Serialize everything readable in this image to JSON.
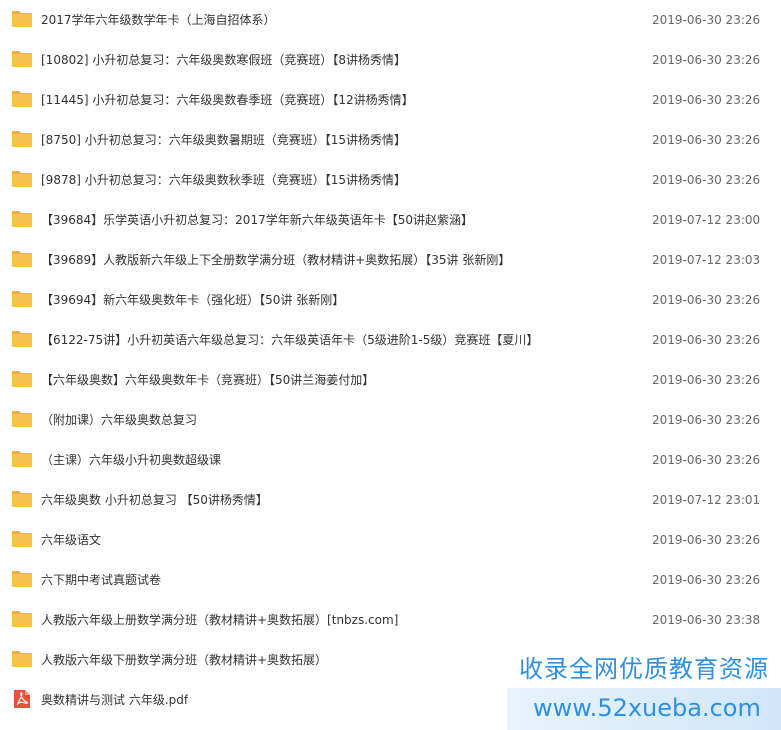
{
  "colors": {
    "folder": "#f7c34a",
    "folder_dark": "#eeb22e",
    "pdf": "#e9503a",
    "watermark": "#2f8fe0"
  },
  "files": [
    {
      "name": "2017学年六年级数学年卡（上海自招体系）",
      "date": "2019-06-30 23:26",
      "icon": "folder-icon"
    },
    {
      "name": "[10802] 小升初总复习：六年级奥数寒假班（竞赛班）【8讲杨秀情】",
      "date": "2019-06-30 23:26",
      "icon": "folder-icon"
    },
    {
      "name": "[11445] 小升初总复习：六年级奥数春季班（竞赛班）【12讲杨秀情】",
      "date": "2019-06-30 23:26",
      "icon": "folder-icon"
    },
    {
      "name": "[8750] 小升初总复习：六年级奥数暑期班（竞赛班）【15讲杨秀情】",
      "date": "2019-06-30 23:26",
      "icon": "folder-icon"
    },
    {
      "name": "[9878] 小升初总复习：六年级奥数秋季班（竞赛班）【15讲杨秀情】",
      "date": "2019-06-30 23:26",
      "icon": "folder-icon"
    },
    {
      "name": "【39684】乐学英语小升初总复习：2017学年新六年级英语年卡【50讲赵紫涵】",
      "date": "2019-07-12 23:00",
      "icon": "folder-icon"
    },
    {
      "name": "【39689】人教版新六年级上下全册数学满分班（教材精讲+奥数拓展）【35讲 张新刚】",
      "date": "2019-07-12 23:03",
      "icon": "folder-icon"
    },
    {
      "name": "【39694】新六年级奥数年卡（强化班）【50讲 张新刚】",
      "date": "2019-06-30 23:26",
      "icon": "folder-icon"
    },
    {
      "name": "【6122-75讲】小升初英语六年级总复习：六年级英语年卡（5级进阶1-5级）竞赛班【夏川】",
      "date": "2019-06-30 23:26",
      "icon": "folder-icon"
    },
    {
      "name": "【六年级奥数】六年级奥数年卡（竞赛班）【50讲兰海姜付加】",
      "date": "2019-06-30 23:26",
      "icon": "folder-icon"
    },
    {
      "name": "（附加课）六年级奥数总复习",
      "date": "2019-06-30 23:26",
      "icon": "folder-icon"
    },
    {
      "name": "（主课）六年级小升初奥数超级课",
      "date": "2019-06-30 23:26",
      "icon": "folder-icon"
    },
    {
      "name": "六年级奥数 小升初总复习 【50讲杨秀情】",
      "date": "2019-07-12 23:01",
      "icon": "folder-icon"
    },
    {
      "name": "六年级语文",
      "date": "2019-06-30 23:26",
      "icon": "folder-icon"
    },
    {
      "name": "六下期中考试真题试卷",
      "date": "2019-06-30 23:26",
      "icon": "folder-icon"
    },
    {
      "name": "人教版六年级上册数学满分班（教材精讲+奥数拓展）[tnbzs.com]",
      "date": "2019-06-30 23:38",
      "icon": "folder-icon"
    },
    {
      "name": "人教版六年级下册数学满分班（教材精讲+奥数拓展）",
      "date": "",
      "icon": "folder-icon"
    },
    {
      "name": "奥数精讲与测试 六年级.pdf",
      "date": "",
      "icon": "pdf-icon"
    }
  ],
  "watermark": {
    "line1": "收录全网优质教育资源",
    "line2": "www.52xueba.com"
  }
}
